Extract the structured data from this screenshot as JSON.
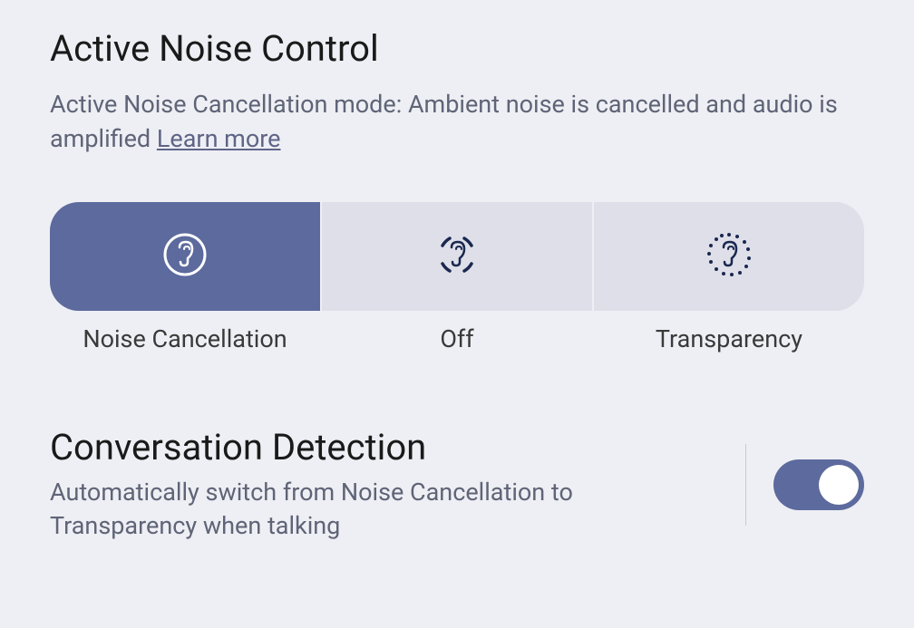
{
  "activeNoiseControl": {
    "title": "Active Noise Control",
    "description": "Active Noise Cancellation mode: Ambient noise is cancelled and audio is amplified ",
    "learnMore": "Learn more",
    "modes": [
      {
        "label": "Noise Cancellation",
        "selected": true
      },
      {
        "label": "Off",
        "selected": false
      },
      {
        "label": "Transparency",
        "selected": false
      }
    ]
  },
  "conversationDetection": {
    "title": "Conversation Detection",
    "description": "Automatically switch from Noise Cancellation to Transparency when talking",
    "enabled": true
  }
}
